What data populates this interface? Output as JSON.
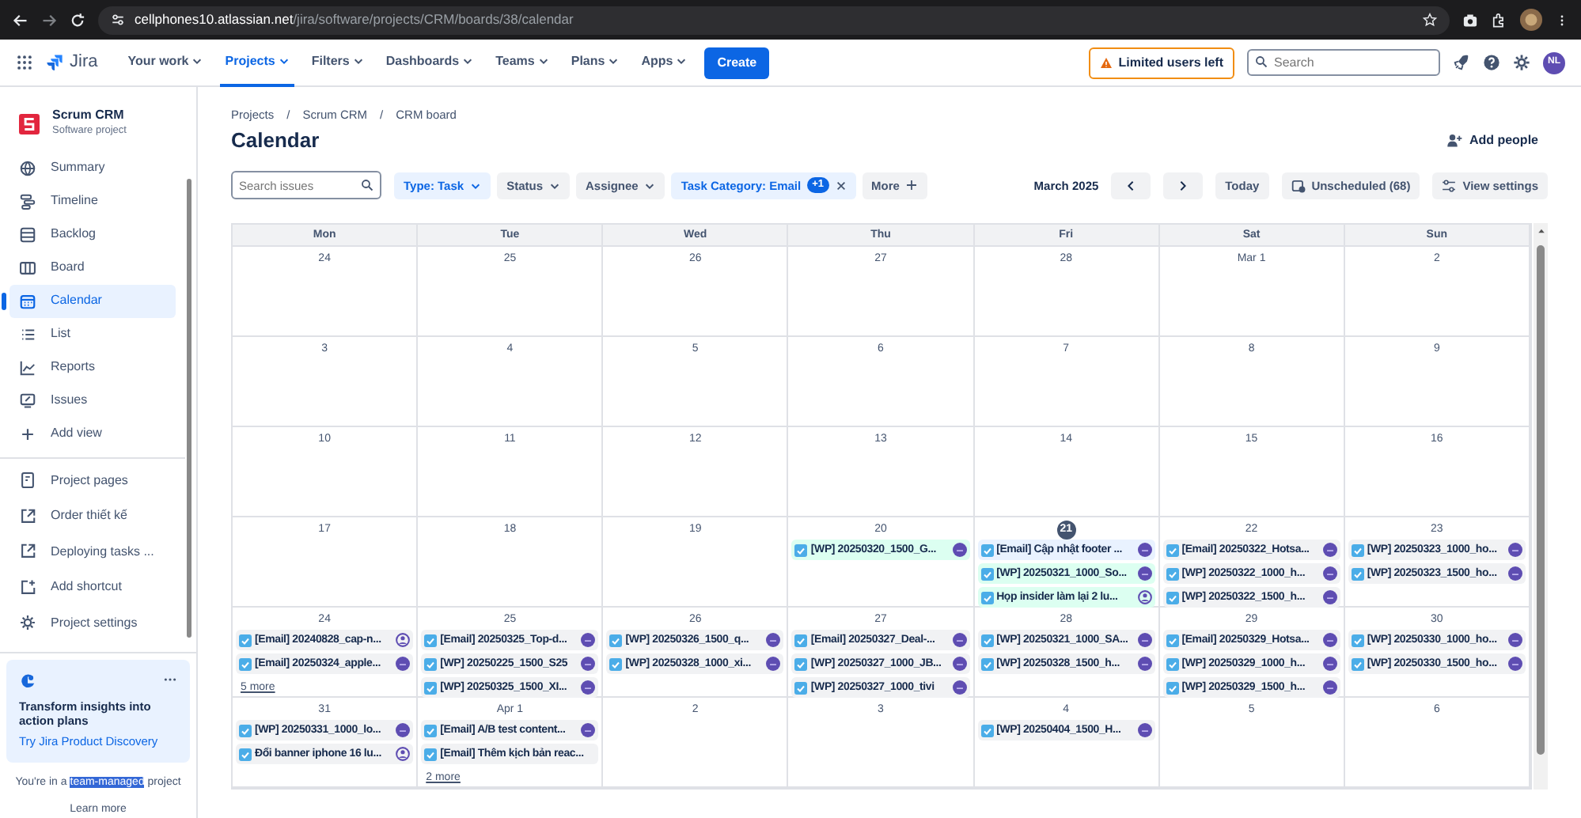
{
  "browser": {
    "url_host": "cellphones10.atlassian.net",
    "url_path": "/jira/software/projects/CRM/boards/38/calendar"
  },
  "topnav": {
    "product": "Jira",
    "items": [
      {
        "label": "Your work",
        "selected": false
      },
      {
        "label": "Projects",
        "selected": true
      },
      {
        "label": "Filters",
        "selected": false
      },
      {
        "label": "Dashboards",
        "selected": false
      },
      {
        "label": "Teams",
        "selected": false
      },
      {
        "label": "Plans",
        "selected": false
      },
      {
        "label": "Apps",
        "selected": false
      }
    ],
    "create": "Create",
    "limited_users": "Limited users left",
    "search_placeholder": "Search",
    "avatar": "NL"
  },
  "sidebar": {
    "project": "Scrum CRM",
    "project_type": "Software project",
    "items": [
      {
        "label": "Summary",
        "selected": false
      },
      {
        "label": "Timeline",
        "selected": false
      },
      {
        "label": "Backlog",
        "selected": false
      },
      {
        "label": "Board",
        "selected": false
      },
      {
        "label": "Calendar",
        "selected": true
      },
      {
        "label": "List",
        "selected": false
      },
      {
        "label": "Reports",
        "selected": false
      },
      {
        "label": "Issues",
        "selected": false
      },
      {
        "label": "Add view",
        "selected": false
      }
    ],
    "links": [
      "Project pages",
      "Order thiết kế",
      "Deploying tasks ...",
      "Add shortcut",
      "Project settings"
    ],
    "promo": {
      "title": "Transform insights into action plans",
      "link": "Try Jira Product Discovery"
    },
    "footer": {
      "before": "You're in a ",
      "highlight": "team-managed",
      "after": " project"
    },
    "learn_more": "Learn more"
  },
  "breadcrumbs": [
    {
      "kind": "link",
      "text": "Projects"
    },
    {
      "kind": "separator",
      "text": "/"
    },
    {
      "kind": "link",
      "text": "Scrum CRM"
    },
    {
      "kind": "separator",
      "text": "/"
    },
    {
      "kind": "link",
      "text": "CRM board"
    }
  ],
  "title": "Calendar",
  "add_people": "Add people",
  "search_placeholder": "Search issues",
  "filters": [
    {
      "label": "Type:",
      "value": "Task",
      "active": true,
      "kind": "dropdown"
    },
    {
      "label": "Status",
      "active": false,
      "kind": "dropdown"
    },
    {
      "label": "Assignee",
      "active": false,
      "kind": "dropdown"
    },
    {
      "label": "Task Category:",
      "value": "Email",
      "badge": "+1",
      "active": true,
      "kind": "clear"
    },
    {
      "label": "More",
      "active": false,
      "kind": "add"
    }
  ],
  "month": "March 2025",
  "today": "Today",
  "unscheduled": "Unscheduled (68)",
  "view_settings": "View settings",
  "weekdays": [
    "Mon",
    "Tue",
    "Wed",
    "Thu",
    "Fri",
    "Sat",
    "Sun"
  ],
  "weeks": [
    {
      "days": [
        {
          "label": "24"
        },
        {
          "label": "25"
        },
        {
          "label": "26"
        },
        {
          "label": "27"
        },
        {
          "label": "28"
        },
        {
          "label": "Mar 1"
        },
        {
          "label": "2"
        }
      ]
    },
    {
      "days": [
        {
          "label": "3"
        },
        {
          "label": "4"
        },
        {
          "label": "5"
        },
        {
          "label": "6"
        },
        {
          "label": "7"
        },
        {
          "label": "8"
        },
        {
          "label": "9"
        }
      ]
    },
    {
      "days": [
        {
          "label": "10"
        },
        {
          "label": "11"
        },
        {
          "label": "12"
        },
        {
          "label": "13"
        },
        {
          "label": "14"
        },
        {
          "label": "15"
        },
        {
          "label": "16"
        }
      ]
    },
    {
      "days": [
        {
          "label": "17"
        },
        {
          "label": "18"
        },
        {
          "label": "19"
        },
        {
          "label": "20",
          "events": [
            {
              "text": "[WP] 20250320_1500_G...",
              "color": "#dcfff1",
              "kind": "assigned"
            }
          ]
        },
        {
          "label": "21",
          "today": true,
          "events": [
            {
              "text": "[Email] Cập nhật footer ...",
              "color": "#e9f2ff",
              "kind": "assigned"
            },
            {
              "text": "[WP] 20250321_1000_So...",
              "color": "#dcfff1",
              "kind": "assigned"
            },
            {
              "text": "Họp insider làm lại 2 lu...",
              "color": "#dcfff1",
              "kind": "unassigned"
            }
          ]
        },
        {
          "label": "22",
          "events": [
            {
              "text": "[Email] 20250322_Hotsa...",
              "color": "#f1f2f4",
              "kind": "assigned"
            },
            {
              "text": "[WP] 20250322_1000_h...",
              "color": "#f1f2f4",
              "kind": "assigned"
            },
            {
              "text": "[WP] 20250322_1500_h...",
              "color": "#f1f2f4",
              "kind": "assigned"
            }
          ]
        },
        {
          "label": "23",
          "events": [
            {
              "text": "[WP] 20250323_1000_ho...",
              "color": "#f1f2f4",
              "kind": "assigned"
            },
            {
              "text": "[WP] 20250323_1500_ho...",
              "color": "#f1f2f4",
              "kind": "assigned"
            }
          ]
        }
      ]
    },
    {
      "days": [
        {
          "label": "24",
          "events": [
            {
              "text": "[Email] 20240828_cap-n...",
              "color": "#f1f2f4",
              "kind": "unassigned"
            },
            {
              "text": "[Email] 20250324_apple...",
              "color": "#f1f2f4",
              "kind": "assigned"
            }
          ],
          "more": "5 more"
        },
        {
          "label": "25",
          "events": [
            {
              "text": "[Email] 20250325_Top-d...",
              "color": "#f1f2f4",
              "kind": "assigned"
            },
            {
              "text": "[WP] 20250225_1500_S25",
              "color": "#f1f2f4",
              "kind": "assigned"
            },
            {
              "text": "[WP] 20250325_1500_XI...",
              "color": "#f1f2f4",
              "kind": "assigned"
            }
          ]
        },
        {
          "label": "26",
          "events": [
            {
              "text": "[WP] 20250326_1500_q...",
              "color": "#f1f2f4",
              "kind": "assigned"
            },
            {
              "text": "[WP] 20250328_1000_xi...",
              "color": "#f1f2f4",
              "kind": "assigned"
            }
          ]
        },
        {
          "label": "27",
          "events": [
            {
              "text": "[Email] 20250327_Deal-...",
              "color": "#f1f2f4",
              "kind": "assigned"
            },
            {
              "text": "[WP] 20250327_1000_JB...",
              "color": "#f1f2f4",
              "kind": "assigned"
            },
            {
              "text": "[WP] 20250327_1000_tivi",
              "color": "#f1f2f4",
              "kind": "assigned"
            }
          ]
        },
        {
          "label": "28",
          "events": [
            {
              "text": "[WP] 20250321_1000_SA...",
              "color": "#f1f2f4",
              "kind": "assigned"
            },
            {
              "text": "[WP] 20250328_1500_h...",
              "color": "#f1f2f4",
              "kind": "assigned"
            }
          ]
        },
        {
          "label": "29",
          "events": [
            {
              "text": "[Email] 20250329_Hotsa...",
              "color": "#f1f2f4",
              "kind": "assigned"
            },
            {
              "text": "[WP] 20250329_1000_h...",
              "color": "#f1f2f4",
              "kind": "assigned"
            },
            {
              "text": "[WP] 20250329_1500_h...",
              "color": "#f1f2f4",
              "kind": "assigned"
            }
          ]
        },
        {
          "label": "30",
          "events": [
            {
              "text": "[WP] 20250330_1000_ho...",
              "color": "#f1f2f4",
              "kind": "assigned"
            },
            {
              "text": "[WP] 20250330_1500_ho...",
              "color": "#f1f2f4",
              "kind": "assigned"
            }
          ]
        }
      ]
    },
    {
      "days": [
        {
          "label": "31",
          "events": [
            {
              "text": "[WP] 20250331_1000_lo...",
              "color": "#f1f2f4",
              "kind": "assigned"
            },
            {
              "text": "Đổi banner iphone 16 lu...",
              "color": "#f1f2f4",
              "kind": "unassigned"
            }
          ]
        },
        {
          "label": "Apr 1",
          "events": [
            {
              "text": "[Email] A/B test content...",
              "color": "#f1f2f4",
              "kind": "assigned"
            },
            {
              "text": "[Email] Thêm kịch bản reac...",
              "color": "#f1f2f4",
              "kind": "plain"
            }
          ],
          "more": "2 more"
        },
        {
          "label": "2"
        },
        {
          "label": "3"
        },
        {
          "label": "4",
          "events": [
            {
              "text": "[WP] 20250404_1500_H...",
              "color": "#f1f2f4",
              "kind": "assigned"
            }
          ]
        },
        {
          "label": "5"
        },
        {
          "label": "6"
        }
      ]
    }
  ]
}
